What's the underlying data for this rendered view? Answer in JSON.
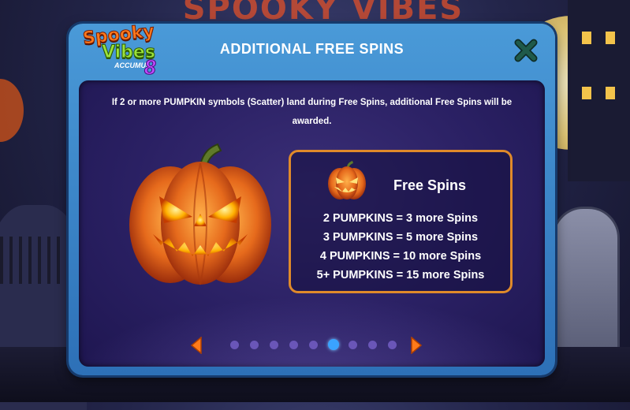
{
  "background": {
    "game_logo_text": "SPOOKY VIBES"
  },
  "panel": {
    "logo": {
      "line1": "Spooky",
      "line2": "Vibes",
      "line3": "ACCUMUL",
      "line4": "8"
    },
    "title": "ADDITIONAL FREE SPINS",
    "description": "If 2 or more PUMPKIN symbols (Scatter) land during Free Spins, additional Free Spins will be awarded.",
    "info_box": {
      "title": "Free Spins",
      "items": [
        "2 PUMPKINS = 3 more Spins",
        "3 PUMPKINS = 5 more Spins",
        "4 PUMPKINS = 10 more Spins",
        "5+ PUMPKINS = 15 more Spins"
      ]
    },
    "pager": {
      "page_count": 9,
      "active_page": 6
    }
  },
  "icons": {
    "close": "close-icon",
    "prev": "chevron-left-icon",
    "next": "chevron-right-icon",
    "pumpkin": "jack-o-lantern-icon"
  },
  "colors": {
    "panel_frame": "#3b86cc",
    "panel_inner": "#2a2063",
    "accent_orange": "#e08a2a",
    "active_dot": "#3aa3ff",
    "inactive_dot": "#6a56b8",
    "close_green": "#1f5a4a"
  }
}
